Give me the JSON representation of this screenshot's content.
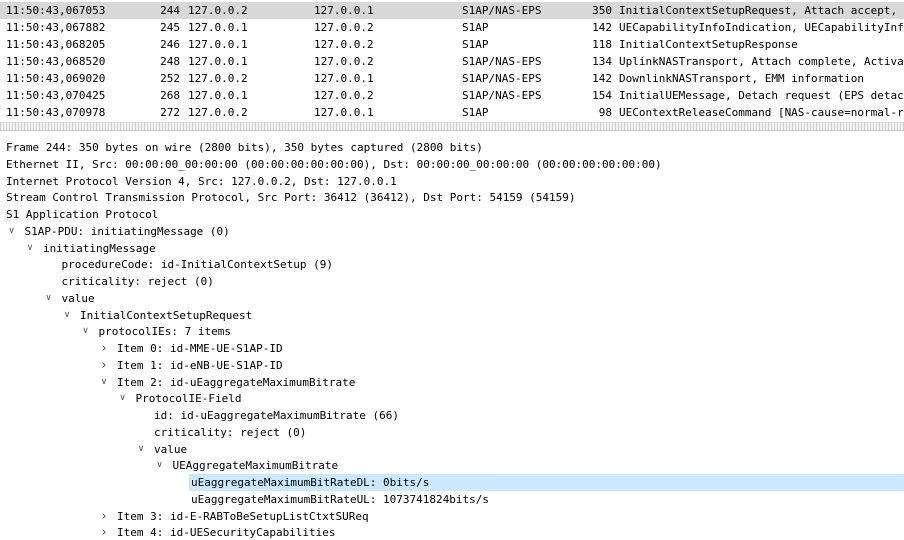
{
  "packets": [
    {
      "time": "11:50:43,067053",
      "no": "244",
      "src": "127.0.0.2",
      "dst": "127.0.0.1",
      "proto": "S1AP/NAS-EPS",
      "len": "350",
      "info": "InitialContextSetupRequest, Attach accept, Activ",
      "selected": true
    },
    {
      "time": "11:50:43,067882",
      "no": "245",
      "src": "127.0.0.1",
      "dst": "127.0.0.2",
      "proto": "S1AP",
      "len": "142",
      "info": "UECapabilityInfoIndication, UECapabilityInfo",
      "selected": false
    },
    {
      "time": "11:50:43,068205",
      "no": "246",
      "src": "127.0.0.1",
      "dst": "127.0.0.2",
      "proto": "S1AP",
      "len": "118",
      "info": "InitialContextSetupResponse",
      "selected": false
    },
    {
      "time": "11:50:43,068520",
      "no": "248",
      "src": "127.0.0.1",
      "dst": "127.0.0.2",
      "proto": "S1AP/NAS-EPS",
      "len": "134",
      "info": "UplinkNASTransport, Attach complete, Activa",
      "selected": false
    },
    {
      "time": "11:50:43,069020",
      "no": "252",
      "src": "127.0.0.2",
      "dst": "127.0.0.1",
      "proto": "S1AP/NAS-EPS",
      "len": "142",
      "info": "DownlinkNASTransport, EMM information",
      "selected": false
    },
    {
      "time": "11:50:43,070425",
      "no": "268",
      "src": "127.0.0.1",
      "dst": "127.0.0.2",
      "proto": "S1AP/NAS-EPS",
      "len": "154",
      "info": "InitialUEMessage, Detach request (EPS detac",
      "selected": false
    },
    {
      "time": "11:50:43,070978",
      "no": "272",
      "src": "127.0.0.2",
      "dst": "127.0.0.1",
      "proto": "S1AP",
      "len": "98",
      "info": "UEContextReleaseCommand [NAS-cause=normal-r",
      "selected": false
    }
  ],
  "tree": [
    {
      "label": "Frame 244: 350 bytes on wire (2800 bits), 350 bytes captured (2800 bits)",
      "level": 0,
      "state": "none"
    },
    {
      "label": "Ethernet II, Src: 00:00:00_00:00:00 (00:00:00:00:00:00), Dst: 00:00:00_00:00:00 (00:00:00:00:00:00)",
      "level": 0,
      "state": "none"
    },
    {
      "label": "Internet Protocol Version 4, Src: 127.0.0.2, Dst: 127.0.0.1",
      "level": 0,
      "state": "none"
    },
    {
      "label": "Stream Control Transmission Protocol, Src Port: 36412 (36412), Dst Port: 54159 (54159)",
      "level": 0,
      "state": "none"
    },
    {
      "label": "S1 Application Protocol",
      "level": 0,
      "state": "none"
    },
    {
      "label": "S1AP-PDU: initiatingMessage (0)",
      "level": 1,
      "state": "expanded"
    },
    {
      "label": "initiatingMessage",
      "level": 2,
      "state": "expanded"
    },
    {
      "label": "procedureCode: id-InitialContextSetup (9)",
      "level": 3,
      "state": "none"
    },
    {
      "label": "criticality: reject (0)",
      "level": 3,
      "state": "none"
    },
    {
      "label": "value",
      "level": 3,
      "state": "expanded"
    },
    {
      "label": "InitialContextSetupRequest",
      "level": 4,
      "state": "expanded"
    },
    {
      "label": "protocolIEs: 7 items",
      "level": 5,
      "state": "expanded"
    },
    {
      "label": "Item 0: id-MME-UE-S1AP-ID",
      "level": 6,
      "state": "collapsed"
    },
    {
      "label": "Item 1: id-eNB-UE-S1AP-ID",
      "level": 6,
      "state": "collapsed"
    },
    {
      "label": "Item 2: id-uEaggregateMaximumBitrate",
      "level": 6,
      "state": "expanded"
    },
    {
      "label": "ProtocolIE-Field",
      "level": 7,
      "state": "expanded"
    },
    {
      "label": "id: id-uEaggregateMaximumBitrate (66)",
      "level": 8,
      "state": "none"
    },
    {
      "label": "criticality: reject (0)",
      "level": 8,
      "state": "none"
    },
    {
      "label": "value",
      "level": 8,
      "state": "expanded"
    },
    {
      "label": "UEAggregateMaximumBitrate",
      "level": 9,
      "state": "expanded"
    },
    {
      "label": "uEaggregateMaximumBitRateDL: 0bits/s",
      "level": 10,
      "state": "none",
      "highlight": true
    },
    {
      "label": "uEaggregateMaximumBitRateUL: 1073741824bits/s",
      "level": 10,
      "state": "none"
    },
    {
      "label": "Item 3: id-E-RABToBeSetupListCtxtSUReq",
      "level": 6,
      "state": "collapsed"
    },
    {
      "label": "Item 4: id-UESecurityCapabilities",
      "level": 6,
      "state": "collapsed"
    }
  ]
}
